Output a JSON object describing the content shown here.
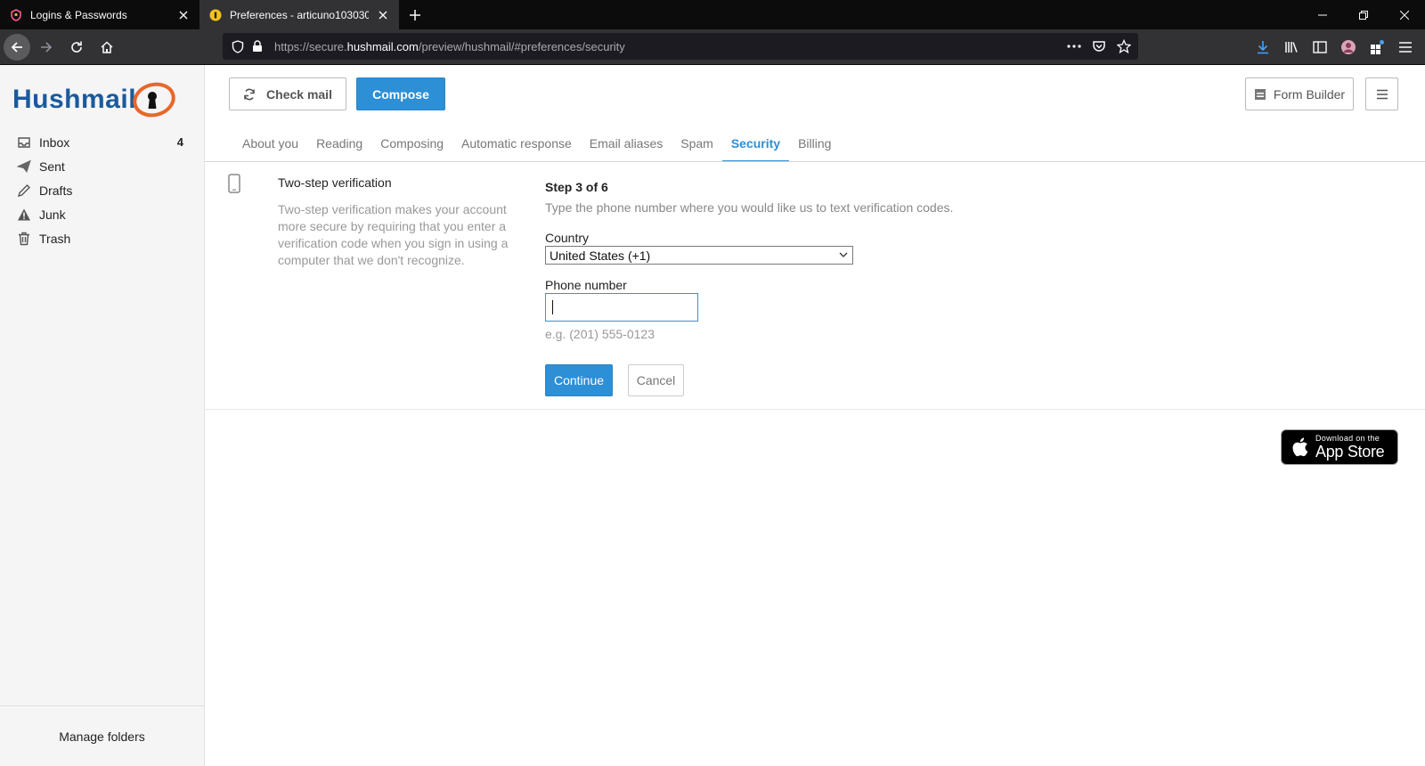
{
  "browser": {
    "tabs": [
      {
        "title": "Logins & Passwords",
        "active": false
      },
      {
        "title": "Preferences - articuno1030301(",
        "active": true
      }
    ],
    "url_prefix": "https://secure.",
    "url_domain": "hushmail.com",
    "url_path": "/preview/hushmail/#preferences/security"
  },
  "sidebar": {
    "logo": "Hushmail",
    "folders": [
      {
        "name": "Inbox",
        "count": "4",
        "icon": "inbox-icon"
      },
      {
        "name": "Sent",
        "count": "",
        "icon": "paper-plane-icon"
      },
      {
        "name": "Drafts",
        "count": "",
        "icon": "pencil-icon"
      },
      {
        "name": "Junk",
        "count": "",
        "icon": "warning-icon"
      },
      {
        "name": "Trash",
        "count": "",
        "icon": "trash-icon"
      }
    ],
    "manage": "Manage folders"
  },
  "toolbar": {
    "check_mail": "Check mail",
    "compose": "Compose",
    "form_builder": "Form Builder"
  },
  "pref_tabs": [
    {
      "label": "About you",
      "active": false
    },
    {
      "label": "Reading",
      "active": false
    },
    {
      "label": "Composing",
      "active": false
    },
    {
      "label": "Automatic response",
      "active": false
    },
    {
      "label": "Email aliases",
      "active": false
    },
    {
      "label": "Spam",
      "active": false
    },
    {
      "label": "Security",
      "active": true
    },
    {
      "label": "Billing",
      "active": false
    }
  ],
  "section": {
    "title": "Two-step verification",
    "description": "Two-step verification makes your account more secure by requiring that you enter a verification code when you sign in using a computer that we don't recognize."
  },
  "form": {
    "step": "Step 3 of 6",
    "instruction": "Type the phone number where you would like us to text verification codes.",
    "country_label": "Country",
    "country_value": "United States (+1)",
    "phone_label": "Phone number",
    "phone_value": "",
    "phone_hint": "e.g. (201) 555-0123",
    "continue": "Continue",
    "cancel": "Cancel"
  },
  "appstore": {
    "small": "Download on the",
    "big": "App Store"
  },
  "colors": {
    "accent": "#2d8fd6",
    "logo_blue": "#1b5a9c",
    "logo_orange": "#e8672a"
  }
}
